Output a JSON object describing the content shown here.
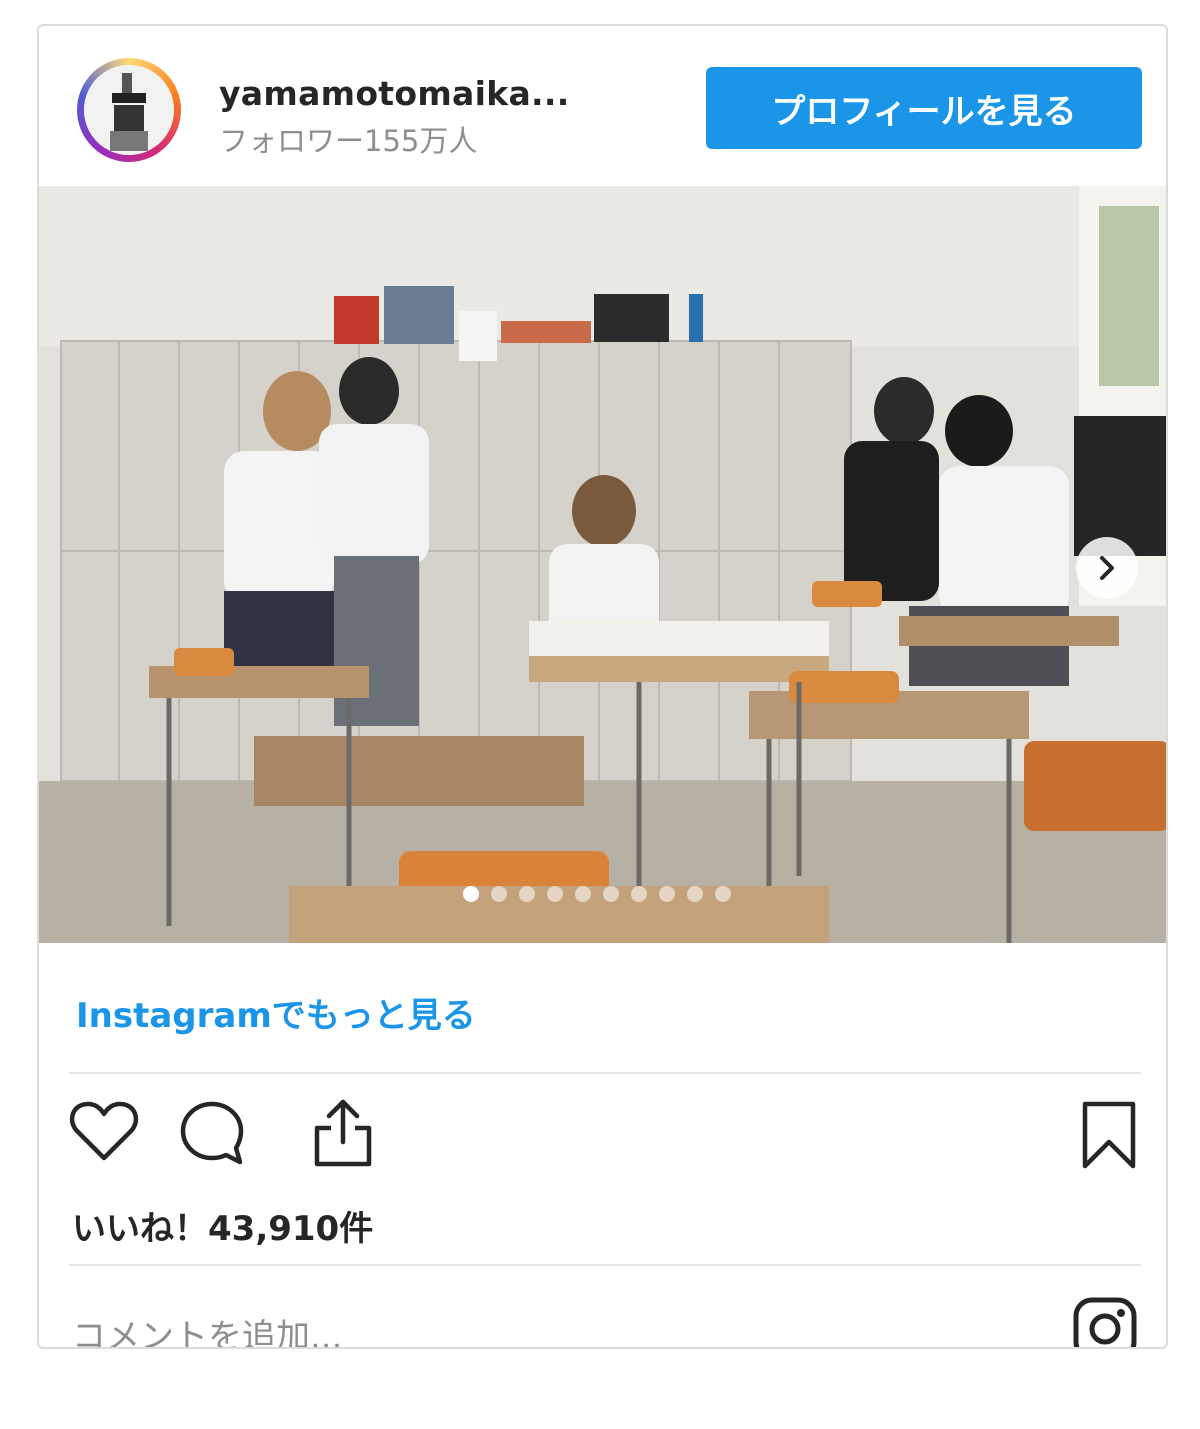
{
  "header": {
    "username": "yamamotomaika...",
    "followers": "フォロワー155万人",
    "profile_button": "プロフィールを見る"
  },
  "carousel": {
    "total_slides": 10,
    "active_slide": 1
  },
  "more_link": "Instagramでもっと見る",
  "likes": "いいね！43,910件",
  "comment_placeholder": "コメントを追加...",
  "icons": {
    "like": "heart-icon",
    "comment": "comment-icon",
    "share": "share-icon",
    "save": "bookmark-icon",
    "next": "chevron-right-icon",
    "brand": "instagram-icon"
  },
  "colors": {
    "accent": "#1a95e8",
    "muted": "#8e8e8e",
    "border": "#dbdbdb"
  }
}
